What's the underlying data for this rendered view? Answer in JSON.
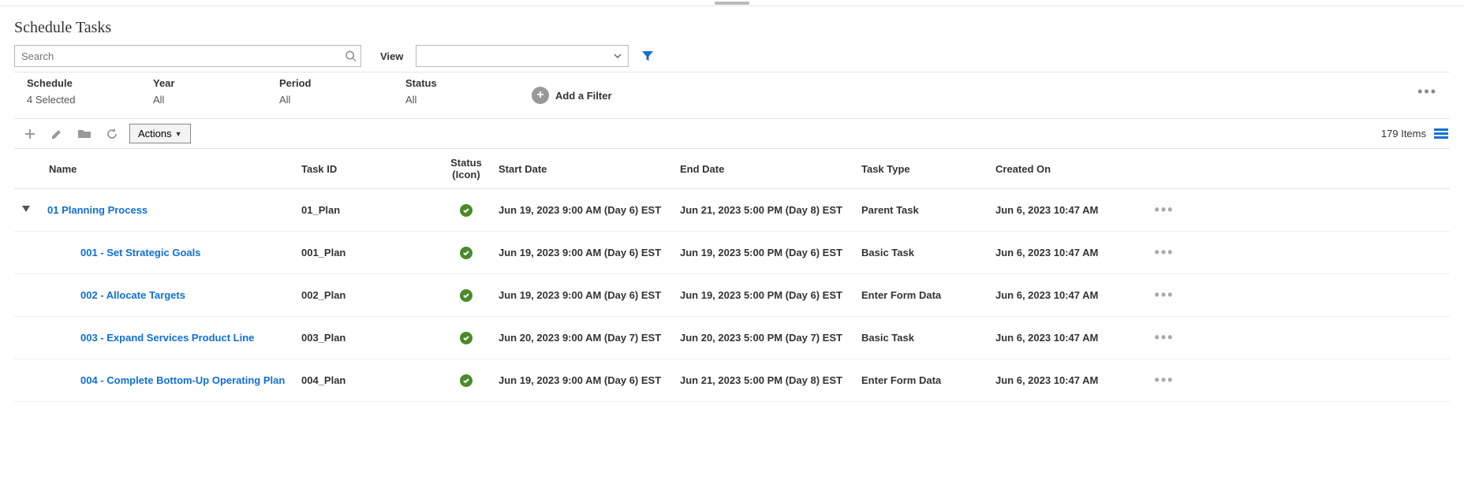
{
  "page_title": "Schedule Tasks",
  "search": {
    "placeholder": "Search"
  },
  "view": {
    "label": "View",
    "value": ""
  },
  "filters": [
    {
      "label": "Schedule",
      "value": "4 Selected"
    },
    {
      "label": "Year",
      "value": "All"
    },
    {
      "label": "Period",
      "value": "All"
    },
    {
      "label": "Status",
      "value": "All"
    }
  ],
  "add_filter_label": "Add a Filter",
  "actions_label": "Actions",
  "item_count_label": "179 Items",
  "columns": {
    "name": "Name",
    "task_id": "Task ID",
    "status_icon": "Status (Icon)",
    "start_date": "Start Date",
    "end_date": "End Date",
    "task_type": "Task Type",
    "created_on": "Created On"
  },
  "rows": [
    {
      "indent": 0,
      "expandable": true,
      "name": "01 Planning Process",
      "task_id": "01_Plan",
      "status": "ok",
      "start_date": "Jun 19, 2023 9:00 AM (Day 6) EST",
      "end_date": "Jun 21, 2023 5:00 PM (Day 8) EST",
      "task_type": "Parent Task",
      "created_on": "Jun 6, 2023 10:47 AM"
    },
    {
      "indent": 1,
      "expandable": false,
      "name": "001 - Set Strategic Goals",
      "task_id": "001_Plan",
      "status": "ok",
      "start_date": "Jun 19, 2023 9:00 AM (Day 6) EST",
      "end_date": "Jun 19, 2023 5:00 PM (Day 6) EST",
      "task_type": "Basic Task",
      "created_on": "Jun 6, 2023 10:47 AM"
    },
    {
      "indent": 1,
      "expandable": false,
      "name": "002 - Allocate Targets",
      "task_id": "002_Plan",
      "status": "ok",
      "start_date": "Jun 19, 2023 9:00 AM (Day 6) EST",
      "end_date": "Jun 19, 2023 5:00 PM (Day 6) EST",
      "task_type": "Enter Form Data",
      "created_on": "Jun 6, 2023 10:47 AM"
    },
    {
      "indent": 1,
      "expandable": false,
      "name": "003 - Expand Services Product Line",
      "task_id": "003_Plan",
      "status": "ok",
      "start_date": "Jun 20, 2023 9:00 AM (Day 7) EST",
      "end_date": "Jun 20, 2023 5:00 PM (Day 7) EST",
      "task_type": "Basic Task",
      "created_on": "Jun 6, 2023 10:47 AM"
    },
    {
      "indent": 1,
      "expandable": false,
      "name": "004 - Complete Bottom-Up Operating Plan",
      "task_id": "004_Plan",
      "status": "ok",
      "start_date": "Jun 19, 2023 9:00 AM (Day 6) EST",
      "end_date": "Jun 21, 2023 5:00 PM (Day 8) EST",
      "task_type": "Enter Form Data",
      "created_on": "Jun 6, 2023 10:47 AM"
    }
  ]
}
